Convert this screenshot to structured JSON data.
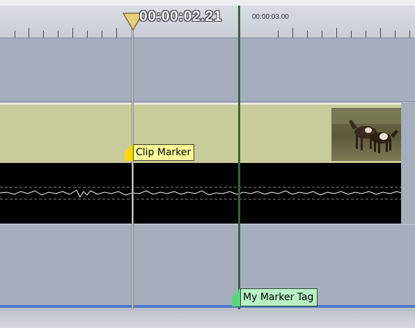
{
  "ruler": {
    "current_time": "00:00:02.21",
    "time_label": "00:00:03.00"
  },
  "markers": {
    "clip_marker_label": "Clip Marker",
    "tag_marker_label": "My Marker Tag"
  },
  "colors": {
    "clip_marker": "#ffff99",
    "tag_marker": "#b9f1c4",
    "video_clip": "#c8cc9a",
    "audio_clip": "#000000",
    "track_bg": "#a6aebe",
    "playhead": "#e8e8e8",
    "edit_line": "#2e6b2e"
  },
  "icons": {
    "playhead": "triangle-down-icon",
    "thumbnail": "horses-thumbnail"
  }
}
